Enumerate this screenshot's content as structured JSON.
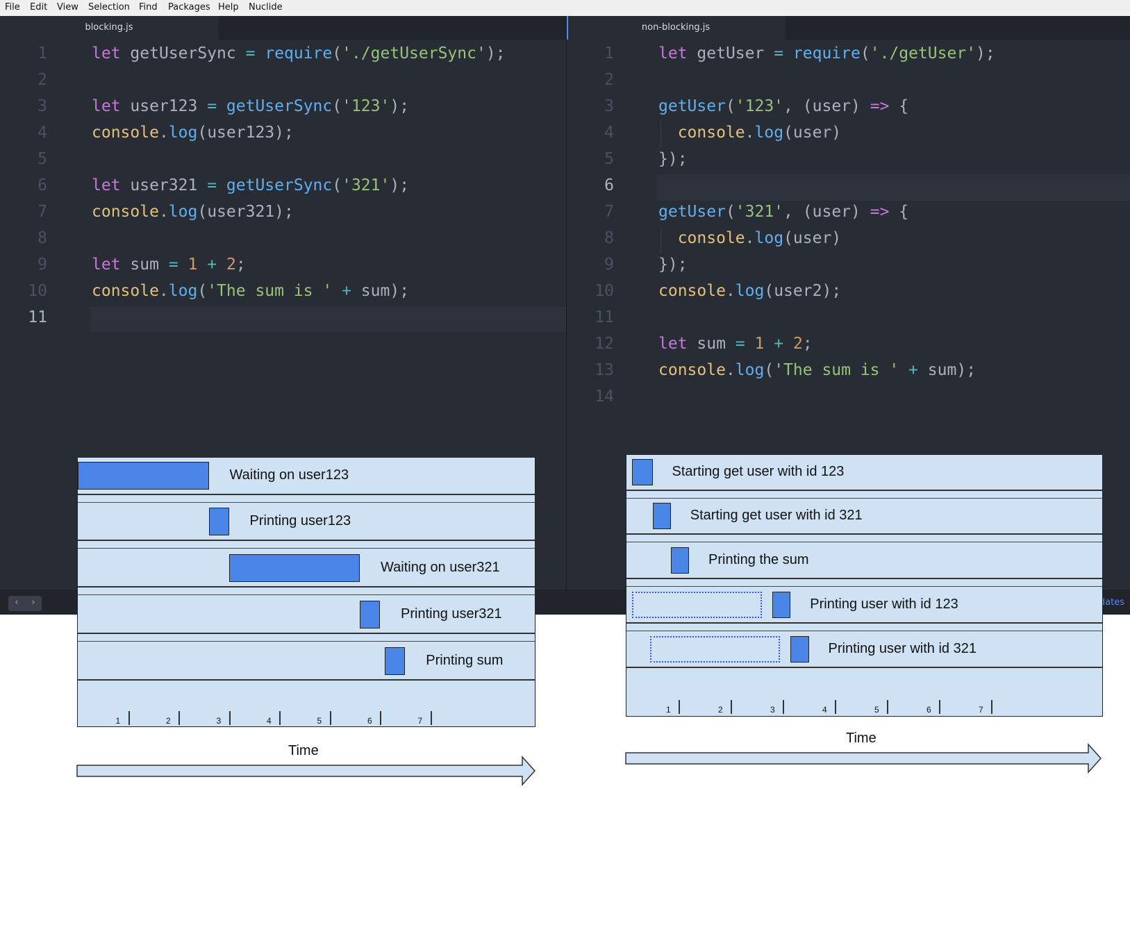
{
  "menu": [
    "File",
    "Edit",
    "View",
    "Selection",
    "Find",
    "Packages",
    "Help",
    "Nuclide"
  ],
  "left_pane": {
    "tab": "blocking.js",
    "active_line": 11,
    "line_numbers": [
      "1",
      "2",
      "3",
      "4",
      "5",
      "6",
      "7",
      "8",
      "9",
      "10",
      "11"
    ],
    "lines": [
      "let getUserSync = require('./getUserSync');",
      "",
      "let user123 = getUserSync('123');",
      "console.log(user123);",
      "",
      "let user321 = getUserSync('321');",
      "console.log(user321);",
      "",
      "let sum = 1 + 2;",
      "console.log('The sum is ' + sum);",
      ""
    ]
  },
  "right_pane": {
    "tab": "non-blocking.js",
    "active_line": 6,
    "line_numbers": [
      "1",
      "2",
      "3",
      "4",
      "5",
      "6",
      "7",
      "8",
      "9",
      "10",
      "11",
      "12",
      "13",
      "14"
    ],
    "lines": [
      "let getUser = require('./getUser');",
      "",
      "getUser('123', (user) => {",
      "  console.log(user)",
      "});",
      "",
      "getUser('321', (user) => {",
      "  console.log(user)",
      "});",
      "console.log(user2);",
      "",
      "let sum = 1 + 2;",
      "console.log('The sum is ' + sum);",
      ""
    ]
  },
  "status_bar": {
    "right_text": "dates"
  },
  "colors": {
    "editor_bg": "#282c34",
    "chart_bg": "#cfe2f3",
    "bar": "#4a86e8",
    "waiting_outline": "#3c4ff0"
  },
  "icons": [
    "chevron-left-icon",
    "chevron-right-icon"
  ],
  "charts": [
    {
      "id": "blocking",
      "axis_title": "Time",
      "ticks": [
        "1",
        "2",
        "3",
        "4",
        "5",
        "6",
        "7"
      ],
      "rows": [
        {
          "label": "Waiting on user123",
          "start": 0.0,
          "end": 2.6
        },
        {
          "label": "Printing user123",
          "start": 2.6,
          "end": 3.0
        },
        {
          "label": "Waiting on user321",
          "start": 3.0,
          "end": 5.6
        },
        {
          "label": "Printing user321",
          "start": 5.6,
          "end": 6.0
        },
        {
          "label": "Printing sum",
          "start": 6.1,
          "end": 6.5
        }
      ]
    },
    {
      "id": "non-blocking",
      "axis_title": "Time",
      "ticks": [
        "1",
        "2",
        "3",
        "4",
        "5",
        "6",
        "7"
      ],
      "rows": [
        {
          "label": "Starting get user with id 123",
          "start": 0.1,
          "end": 0.5
        },
        {
          "label": "Starting get user with id 321",
          "start": 0.5,
          "end": 0.85
        },
        {
          "label": "Printing the sum",
          "start": 0.85,
          "end": 1.2
        },
        {
          "label": "Printing user with id 123",
          "wait_start": 0.1,
          "wait_end": 2.6,
          "start": 2.8,
          "end": 3.15
        },
        {
          "label": "Printing user with id 321",
          "wait_start": 0.45,
          "wait_end": 2.95,
          "start": 3.15,
          "end": 3.5
        }
      ]
    }
  ]
}
